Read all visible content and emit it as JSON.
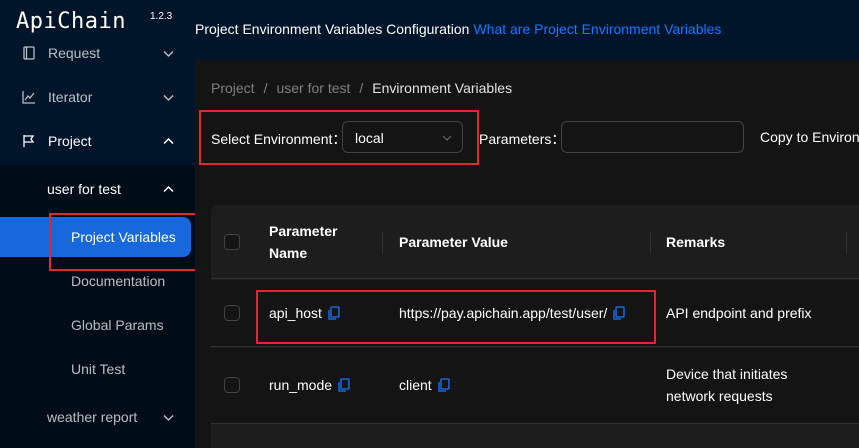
{
  "app": {
    "logo": "ApiChain",
    "version": "1.2.3"
  },
  "sidebar": {
    "items": [
      {
        "label": "Request",
        "icon": "request-icon"
      },
      {
        "label": "Iterator",
        "icon": "iterator-icon"
      },
      {
        "label": "Project",
        "icon": "flag-icon"
      }
    ],
    "project_submenu": {
      "label": "user for test",
      "children": [
        {
          "label": "Project Variables"
        },
        {
          "label": "Documentation"
        },
        {
          "label": "Global Params"
        },
        {
          "label": "Unit Test"
        }
      ]
    },
    "weather": {
      "label": "weather report"
    }
  },
  "header": {
    "title": "Project Environment Variables Configuration",
    "link": "What are Project Environment Variables"
  },
  "breadcrumb": [
    "Project",
    "user for test",
    "Environment Variables"
  ],
  "breadcrumb_sep": "/",
  "filters": {
    "env_label": "Select Environment：",
    "env_value": "local",
    "params_label": "Parameters：",
    "params_value": "",
    "copy_label": "Copy to Environ"
  },
  "table": {
    "headers": [
      "Parameter Name",
      "Parameter Value",
      "Remarks"
    ],
    "rows": [
      {
        "name": "api_host",
        "value": "https://pay.apichain.app/test/user/",
        "remarks": "API endpoint and prefix"
      },
      {
        "name": "run_mode",
        "value": "client",
        "remarks": "Device that initiates network requests"
      }
    ]
  },
  "colors": {
    "sidebar_bg": "#001529",
    "submenu_bg": "#000c17",
    "active": "#1668dc",
    "link": "#1677ff",
    "highlight": "#e0282e",
    "copy_icon": "#1677ff"
  }
}
